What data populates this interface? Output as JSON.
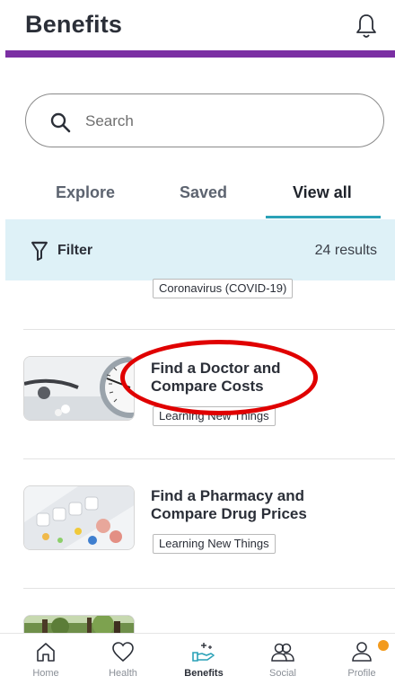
{
  "header": {
    "title": "Benefits"
  },
  "search": {
    "placeholder": "Search"
  },
  "tabs": [
    {
      "label": "Explore",
      "active": false
    },
    {
      "label": "Saved",
      "active": false
    },
    {
      "label": "View all",
      "active": true
    }
  ],
  "filter": {
    "label": "Filter",
    "results": "24 results"
  },
  "items": [
    {
      "title": "",
      "tag": "Coronavirus (COVID-19)"
    },
    {
      "title_line1": "Find a Doctor and",
      "title_line2": "Compare Costs",
      "tag": "Learning New Things"
    },
    {
      "title_line1": "Find a Pharmacy and",
      "title_line2": "Compare Drug Prices",
      "tag": "Learning New Things"
    }
  ],
  "bottom_nav": [
    {
      "label": "Home",
      "icon": "home-icon",
      "active": false
    },
    {
      "label": "Health",
      "icon": "heart-icon",
      "active": false
    },
    {
      "label": "Benefits",
      "icon": "hand-plus-icon",
      "active": true
    },
    {
      "label": "Social",
      "icon": "people-icon",
      "active": false
    },
    {
      "label": "Profile",
      "icon": "person-icon",
      "active": false
    }
  ],
  "colors": {
    "accent_purple": "#7b2fa3",
    "tab_underline": "#2aa1b7",
    "filter_bg": "#def1f7",
    "annotation_red": "#e00000",
    "badge_orange": "#f39a1d"
  }
}
